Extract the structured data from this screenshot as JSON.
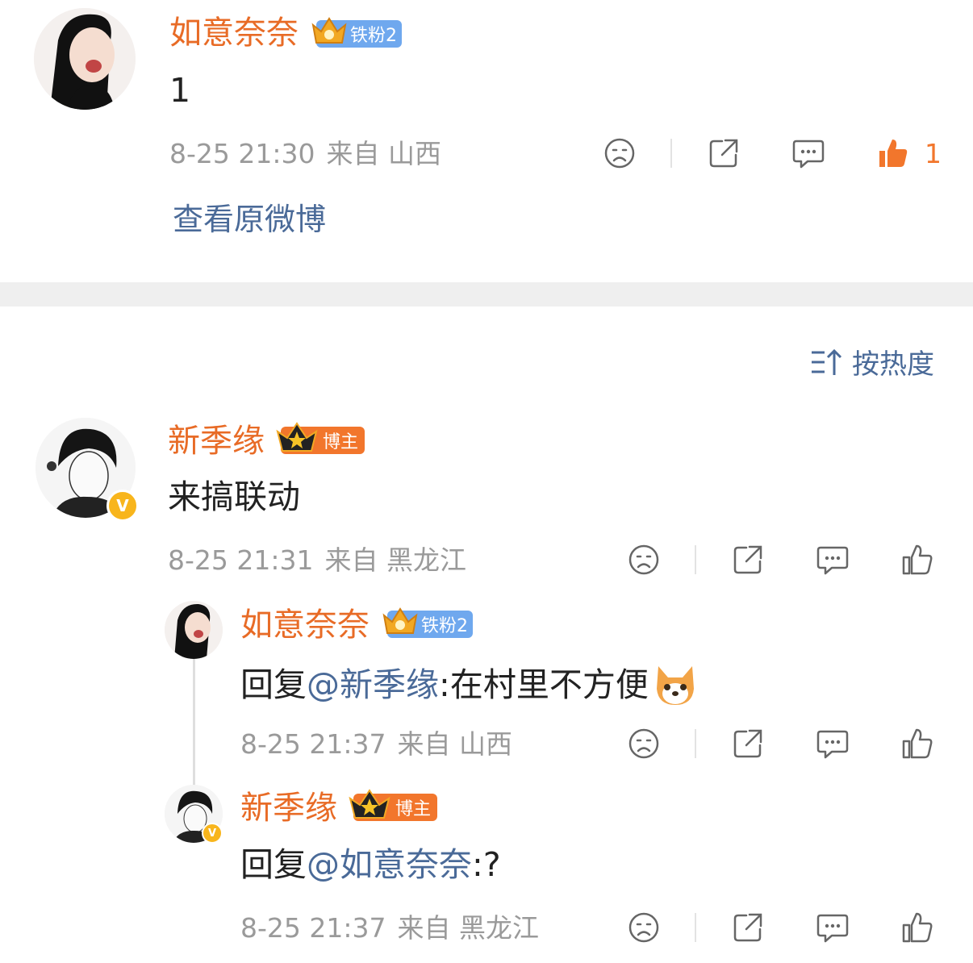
{
  "top_comment": {
    "user_name": "如意奈奈",
    "badge_label": "铁粉2",
    "text": "1",
    "date": "8-25 21:30",
    "source": "来自 山西",
    "like_count": "1",
    "view_original_label": "查看原微博"
  },
  "sort": {
    "label": "按热度"
  },
  "comments": [
    {
      "user_name": "新季缘",
      "badge_label": "博主",
      "text": "来搞联动",
      "date": "8-25 21:31",
      "source": "来自 黑龙江"
    }
  ],
  "replies": [
    {
      "user_name": "如意奈奈",
      "badge_label": "铁粉2",
      "prefix": "回复",
      "mention": "@新季缘",
      "text": ":在村里不方便",
      "date": "8-25 21:37",
      "source": "来自 山西"
    },
    {
      "user_name": "新季缘",
      "badge_label": "博主",
      "prefix": "回复",
      "mention": "@如意奈奈",
      "text": ":?",
      "date": "8-25 21:37",
      "source": "来自 黑龙江"
    }
  ],
  "colors": {
    "name": "#e86b26",
    "link": "#4a6a98",
    "meta": "#9a9a9a",
    "like_active": "#f2762c",
    "fan_badge": "#6fa8ee",
    "host_badge": "#f2762c"
  }
}
